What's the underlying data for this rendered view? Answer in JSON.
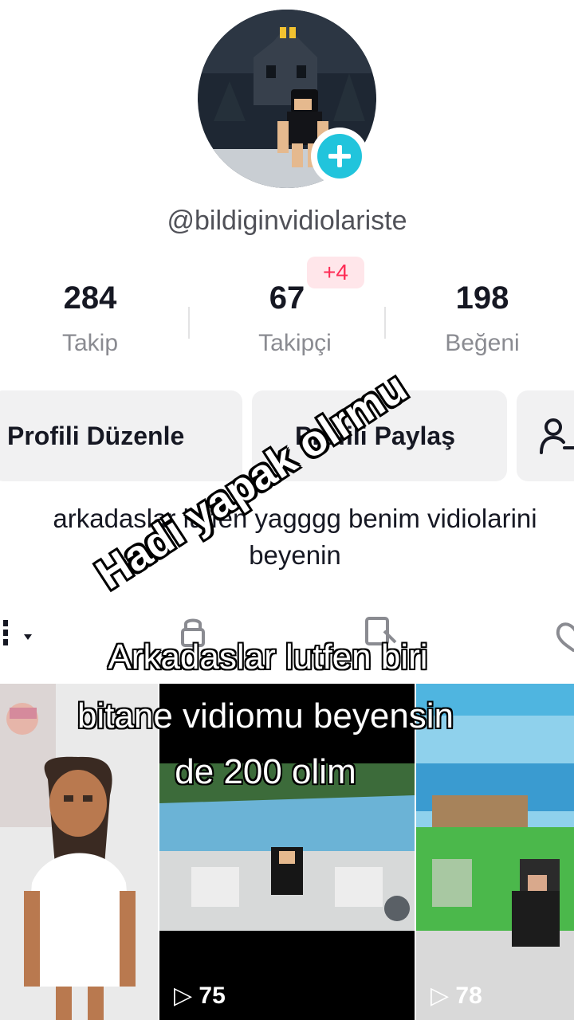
{
  "profile": {
    "username": "@bildiginvidiolariste",
    "avatar_icon": "roblox-avatar-haunted-house",
    "add_icon": "plus-icon"
  },
  "stats": [
    {
      "value": "284",
      "label": "Takip"
    },
    {
      "value": "67",
      "label": "Takipçi",
      "badge": "+4"
    },
    {
      "value": "198",
      "label": "Beğeni"
    }
  ],
  "buttons": {
    "edit": "Profili Düzenle",
    "share": "Profili Paylaş",
    "add_friend_icon": "add-friend-icon"
  },
  "bio": {
    "line1": "arkadaslar lutfen yagggg benim vidiolarini",
    "line2": "beyenin"
  },
  "tabs": [
    "grid-icon",
    "lock-icon",
    "repost-icon",
    "heart-icon"
  ],
  "videos": [
    {
      "thumb": "girl-in-white-dress",
      "views": ""
    },
    {
      "thumb": "roblox-pool",
      "views": "75"
    },
    {
      "thumb": "roblox-island",
      "views": "78"
    }
  ],
  "overlay": {
    "diagonal": "Hadi yapak olrmu",
    "caption_lines": [
      "Arkadaslar lutfen biri",
      "bitane vidiomu beyensin",
      "de 200 olim"
    ]
  },
  "colors": {
    "accent": "#fe2c55",
    "add_button": "#21c4dc",
    "button_bg": "#f1f1f2"
  }
}
